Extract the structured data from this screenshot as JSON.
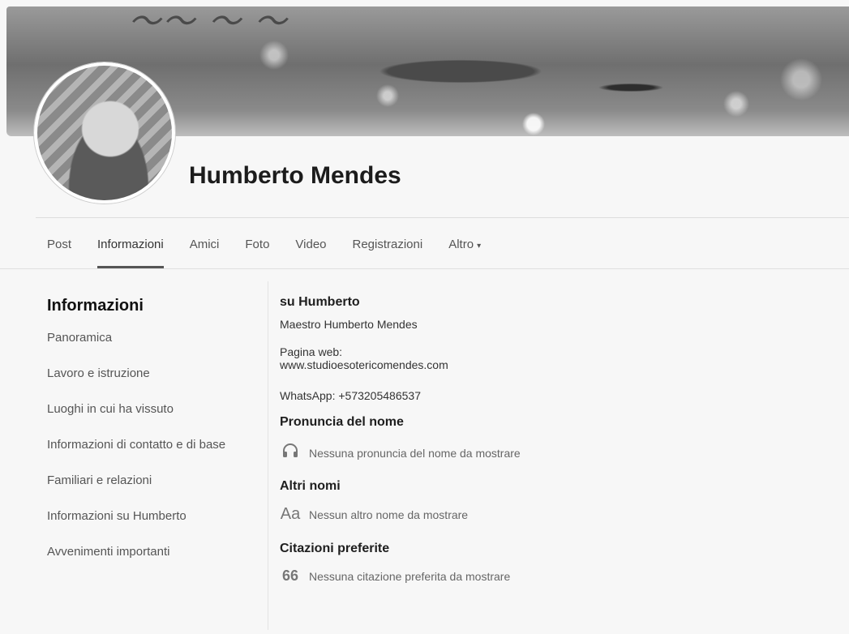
{
  "profile": {
    "name": "Humberto Mendes"
  },
  "tabs": [
    {
      "label": "Post"
    },
    {
      "label": "Informazioni"
    },
    {
      "label": "Amici"
    },
    {
      "label": "Foto"
    },
    {
      "label": "Video"
    },
    {
      "label": "Registrazioni"
    },
    {
      "label": "Altro",
      "caret": "▾"
    }
  ],
  "sidebar": {
    "title": "Informazioni",
    "items": [
      {
        "label": "Panoramica"
      },
      {
        "label": "Lavoro e istruzione"
      },
      {
        "label": "Luoghi in cui ha vissuto"
      },
      {
        "label": "Informazioni di contatto e di base"
      },
      {
        "label": "Familiari e relazioni"
      },
      {
        "label": "Informazioni su Humberto"
      },
      {
        "label": "Avvenimenti importanti"
      }
    ]
  },
  "about": {
    "heading": "su Humberto",
    "bio_line": "Maestro Humberto Mendes",
    "website_label": "Pagina web:",
    "website_url": "www.studioesotericomendes.com",
    "whatsapp": "WhatsApp: +573205486537"
  },
  "name_pronunciation": {
    "heading": "Pronuncia del nome",
    "empty_text": "Nessuna pronuncia del nome da mostrare",
    "icon": "headphones-icon"
  },
  "other_names": {
    "heading": "Altri nomi",
    "empty_text": "Nessun altro nome da mostrare",
    "icon_glyph": "Aa"
  },
  "favorite_quotes": {
    "heading": "Citazioni preferite",
    "empty_text": "Nessuna citazione preferita da mostrare",
    "icon_glyph": "66"
  }
}
